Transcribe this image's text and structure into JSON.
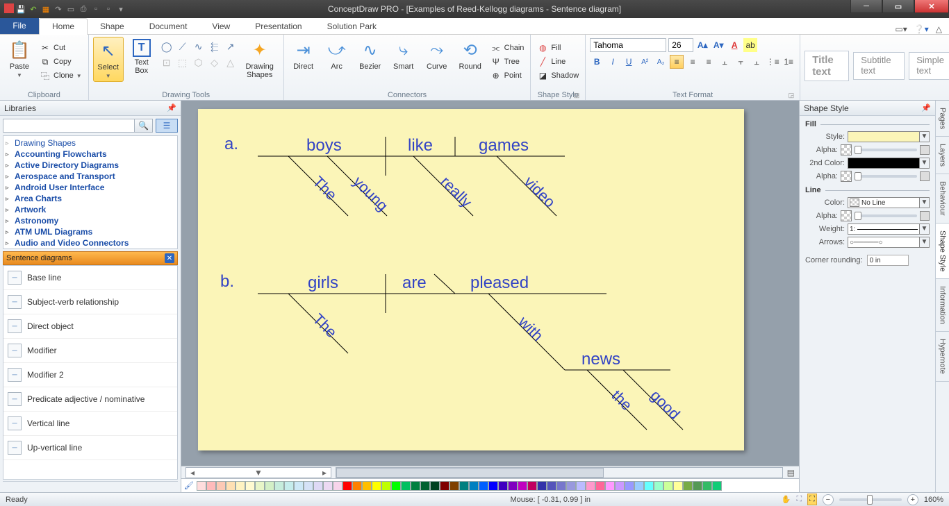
{
  "app_title": "ConceptDraw PRO - [Examples of Reed-Kellogg diagrams - Sentence diagram]",
  "tabs": {
    "file": "File",
    "home": "Home",
    "shape": "Shape",
    "document": "Document",
    "view": "View",
    "presentation": "Presentation",
    "solution": "Solution Park"
  },
  "clipboard": {
    "paste": "Paste",
    "cut": "Cut",
    "copy": "Copy",
    "clone": "Clone",
    "group": "Clipboard"
  },
  "tools": {
    "select": "Select",
    "textbox": "Text Box",
    "drawshapes": "Drawing Shapes",
    "group": "Drawing Tools"
  },
  "connectors": {
    "direct": "Direct",
    "arc": "Arc",
    "bezier": "Bezier",
    "smart": "Smart",
    "curve": "Curve",
    "round": "Round",
    "chain": "Chain",
    "tree": "Tree",
    "point": "Point",
    "group": "Connectors"
  },
  "shapestyle": {
    "fill": "Fill",
    "line": "Line",
    "shadow": "Shadow",
    "group": "Shape Style"
  },
  "textformat": {
    "font": "Tahoma",
    "size": "26",
    "group": "Text Format"
  },
  "style_prev": {
    "title": "Title text",
    "subtitle": "Subtitle text",
    "simple": "Simple text"
  },
  "libraries": {
    "title": "Libraries",
    "items": [
      "Drawing Shapes",
      "Accounting Flowcharts",
      "Active Directory Diagrams",
      "Aerospace and Transport",
      "Android User Interface",
      "Area Charts",
      "Artwork",
      "Astronomy",
      "ATM UML Diagrams",
      "Audio and Video Connectors"
    ]
  },
  "sentence_panel": {
    "title": "Sentence diagrams",
    "items": [
      "Base line",
      "Subject-verb relationship",
      "Direct object",
      "Modifier",
      "Modifier 2",
      "Predicate adjective / nominative",
      "Vertical line",
      "Up-vertical line"
    ]
  },
  "right": {
    "title": "Shape Style",
    "fill_h": "Fill",
    "style": "Style:",
    "alpha": "Alpha:",
    "second": "2nd Color:",
    "line_h": "Line",
    "color": "Color:",
    "weight": "Weight:",
    "arrows": "Arrows:",
    "corner": "Corner rounding:",
    "noline": "No Line",
    "weight_val": "1:",
    "corner_val": "0 in",
    "tabs": [
      "Pages",
      "Layers",
      "Behaviour",
      "Shape Style",
      "Information",
      "Hypernote"
    ]
  },
  "status": {
    "ready": "Ready",
    "mouse": "Mouse: [ -0.31, 0.99 ] in",
    "zoom": "160%"
  },
  "diagram": {
    "a_label": "a.",
    "b_label": "b.",
    "a": {
      "subj": "boys",
      "verb": "like",
      "obj": "games",
      "mods_s": [
        "The",
        "young"
      ],
      "mod_v": "really",
      "mod_o": "video"
    },
    "b": {
      "subj": "girls",
      "verb": "are",
      "comp": "pleased",
      "mod_s": "The",
      "prep": "with",
      "np": "news",
      "np_mods": [
        "the",
        "good"
      ]
    }
  },
  "palette_colors": [
    "#fdd",
    "#fbb",
    "#fcc9b5",
    "#ffe0b3",
    "#fff3c2",
    "#fffad1",
    "#e8f5c8",
    "#d3efc6",
    "#c6ecdc",
    "#c5ecec",
    "#cde8f7",
    "#d5e2f7",
    "#ded9f5",
    "#ecd9f2",
    "#f7d4ea",
    "#f00",
    "#ff8000",
    "#ffbf00",
    "#ff0",
    "#bfff00",
    "#0f0",
    "#00c060",
    "#008040",
    "#006030",
    "#004020",
    "#800000",
    "#804000",
    "#008080",
    "#0080c0",
    "#0060ff",
    "#0000ff",
    "#4000c0",
    "#8000c0",
    "#c000c0",
    "#c00060",
    "#33a",
    "#55b",
    "#77c",
    "#99d",
    "#bbf",
    "#ff99cc",
    "#ff6699",
    "#ff99ff",
    "#cc99ff",
    "#9999ff",
    "#99ccff",
    "#66ffff",
    "#99ffcc",
    "#ccff99",
    "#ffff99",
    "#7a4",
    "#595",
    "#3b6",
    "#1c7"
  ]
}
